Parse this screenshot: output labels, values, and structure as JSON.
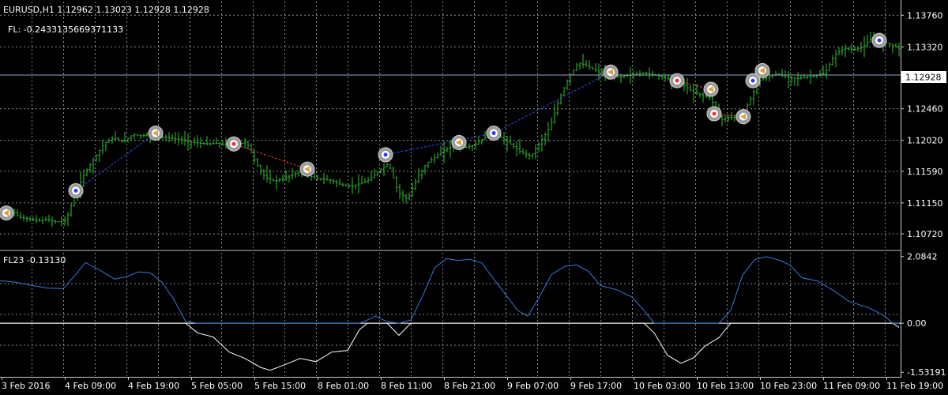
{
  "header": {
    "symbol_line": "EURUSD,H1  1.12962 1.13023 1.12928 1.12928",
    "fl_line": "FL: -0.2433135669371133"
  },
  "colors": {
    "background": "#000000",
    "grid": "#8a8a8a",
    "candle": "#2fbf2f",
    "text": "#ffffff",
    "price_line": "#8fa6c8",
    "fl_positive": "#3a78d8",
    "fl_negative": "#ffffff",
    "marker_ring": "#9a9a9a",
    "marker_buy": "#2a3cff",
    "marker_sell": "#ff2a2a",
    "marker_neutral": "#e0a040",
    "link_red": "#ff3030",
    "link_blue": "#3050ff"
  },
  "chart_data": [
    {
      "type": "line",
      "name": "price",
      "ylim": [
        1.105,
        1.1395
      ],
      "y_ticks": [
        "1.13760",
        "1.13320",
        "1.12928",
        "1.12460",
        "1.12020",
        "1.11590",
        "1.11150",
        "1.10720"
      ],
      "y_tick_values": [
        1.1376,
        1.1332,
        1.12928,
        1.1246,
        1.1202,
        1.1159,
        1.1115,
        1.1072
      ],
      "current_price": 1.12928,
      "current_price_label": "1.12928",
      "points": [
        [
          0,
          1.11
        ],
        [
          12,
          1.1108
        ],
        [
          24,
          1.1095
        ],
        [
          36,
          1.1093
        ],
        [
          48,
          1.109
        ],
        [
          60,
          1.1092
        ],
        [
          72,
          1.1088
        ],
        [
          84,
          1.1092
        ],
        [
          96,
          1.113
        ],
        [
          108,
          1.1158
        ],
        [
          120,
          1.1178
        ],
        [
          132,
          1.1198
        ],
        [
          144,
          1.1205
        ],
        [
          156,
          1.12
        ],
        [
          168,
          1.121
        ],
        [
          180,
          1.1208
        ],
        [
          192,
          1.1212
        ],
        [
          204,
          1.1207
        ],
        [
          216,
          1.1205
        ],
        [
          228,
          1.1203
        ],
        [
          240,
          1.12
        ],
        [
          252,
          1.1198
        ],
        [
          264,
          1.1197
        ],
        [
          276,
          1.1198
        ],
        [
          288,
          1.1195
        ],
        [
          300,
          1.1196
        ],
        [
          312,
          1.12
        ],
        [
          324,
          1.117
        ],
        [
          336,
          1.115
        ],
        [
          348,
          1.1145
        ],
        [
          360,
          1.115
        ],
        [
          372,
          1.1155
        ],
        [
          384,
          1.116
        ],
        [
          396,
          1.115
        ],
        [
          408,
          1.1148
        ],
        [
          420,
          1.1146
        ],
        [
          432,
          1.114
        ],
        [
          444,
          1.1138
        ],
        [
          456,
          1.1142
        ],
        [
          468,
          1.1148
        ],
        [
          480,
          1.116
        ],
        [
          492,
          1.117
        ],
        [
          504,
          1.113
        ],
        [
          516,
          1.112
        ],
        [
          528,
          1.115
        ],
        [
          540,
          1.117
        ],
        [
          552,
          1.118
        ],
        [
          564,
          1.119
        ],
        [
          576,
          1.1195
        ],
        [
          588,
          1.1192
        ],
        [
          600,
          1.1195
        ],
        [
          612,
          1.1205
        ],
        [
          624,
          1.121
        ],
        [
          636,
          1.1205
        ],
        [
          648,
          1.1195
        ],
        [
          660,
          1.1185
        ],
        [
          672,
          1.118
        ],
        [
          684,
          1.12
        ],
        [
          696,
          1.122
        ],
        [
          708,
          1.126
        ],
        [
          720,
          1.129
        ],
        [
          732,
          1.131
        ],
        [
          744,
          1.1305
        ],
        [
          756,
          1.1298
        ],
        [
          768,
          1.1293
        ],
        [
          780,
          1.129
        ],
        [
          792,
          1.1292
        ],
        [
          804,
          1.1294
        ],
        [
          816,
          1.1296
        ],
        [
          828,
          1.1293
        ],
        [
          840,
          1.129
        ],
        [
          852,
          1.1285
        ],
        [
          864,
          1.128
        ],
        [
          876,
          1.127
        ],
        [
          888,
          1.1265
        ],
        [
          900,
          1.126
        ],
        [
          912,
          1.123
        ],
        [
          924,
          1.1235
        ],
        [
          936,
          1.1232
        ],
        [
          948,
          1.1255
        ],
        [
          960,
          1.1285
        ],
        [
          972,
          1.129
        ],
        [
          984,
          1.1295
        ],
        [
          996,
          1.129
        ],
        [
          1008,
          1.1288
        ],
        [
          1020,
          1.129
        ],
        [
          1032,
          1.1292
        ],
        [
          1044,
          1.1295
        ],
        [
          1056,
          1.132
        ],
        [
          1068,
          1.133
        ],
        [
          1080,
          1.1328
        ],
        [
          1092,
          1.1332
        ],
        [
          1104,
          1.1345
        ],
        [
          1116,
          1.134
        ],
        [
          1128,
          1.1335
        ],
        [
          1138,
          1.133
        ]
      ],
      "markers": [
        {
          "x": 8,
          "y": 1.1101,
          "type": "neutral"
        },
        {
          "x": 96,
          "y": 1.1132,
          "type": "buy"
        },
        {
          "x": 197,
          "y": 1.1212,
          "type": "neutral"
        },
        {
          "x": 296,
          "y": 1.1197,
          "type": "sell"
        },
        {
          "x": 389,
          "y": 1.1162,
          "type": "neutral"
        },
        {
          "x": 488,
          "y": 1.1182,
          "type": "buy"
        },
        {
          "x": 581,
          "y": 1.1199,
          "type": "neutral"
        },
        {
          "x": 625,
          "y": 1.1212,
          "type": "buy"
        },
        {
          "x": 773,
          "y": 1.1297,
          "type": "neutral"
        },
        {
          "x": 857,
          "y": 1.1285,
          "type": "sell"
        },
        {
          "x": 900,
          "y": 1.1273,
          "type": "neutral"
        },
        {
          "x": 904,
          "y": 1.1239,
          "type": "sell"
        },
        {
          "x": 941,
          "y": 1.1235,
          "type": "neutral"
        },
        {
          "x": 953,
          "y": 1.1285,
          "type": "buy"
        },
        {
          "x": 965,
          "y": 1.1299,
          "type": "neutral"
        },
        {
          "x": 1113,
          "y": 1.1341,
          "type": "buy"
        }
      ],
      "links": [
        {
          "from": [
            96,
            1.1132
          ],
          "to": [
            197,
            1.1212
          ],
          "color": "blue"
        },
        {
          "from": [
            296,
            1.1197
          ],
          "to": [
            389,
            1.1162
          ],
          "color": "red"
        },
        {
          "from": [
            488,
            1.1182
          ],
          "to": [
            625,
            1.1212
          ],
          "color": "blue"
        },
        {
          "from": [
            625,
            1.1212
          ],
          "to": [
            773,
            1.1297
          ],
          "color": "blue"
        },
        {
          "from": [
            857,
            1.1285
          ],
          "to": [
            900,
            1.1273
          ],
          "color": "red"
        },
        {
          "from": [
            904,
            1.1239
          ],
          "to": [
            941,
            1.1235
          ],
          "color": "red"
        }
      ]
    },
    {
      "type": "line",
      "name": "FL23",
      "label": "FL23 -0.13130",
      "ylim": [
        -1.65,
        2.2
      ],
      "y_ticks": [
        "2.0842",
        "0.00",
        "-1.53191"
      ],
      "y_tick_values": [
        2.0842,
        0.0,
        -1.53191
      ],
      "points": [
        [
          0,
          1.33
        ],
        [
          20,
          1.28
        ],
        [
          40,
          1.18
        ],
        [
          60,
          1.1
        ],
        [
          80,
          1.08
        ],
        [
          95,
          1.5
        ],
        [
          108,
          1.9
        ],
        [
          125,
          1.68
        ],
        [
          145,
          1.38
        ],
        [
          160,
          1.45
        ],
        [
          175,
          1.6
        ],
        [
          190,
          1.58
        ],
        [
          205,
          1.28
        ],
        [
          220,
          0.75
        ],
        [
          235,
          0.05
        ],
        [
          250,
          -0.3
        ],
        [
          270,
          -0.43
        ],
        [
          290,
          -0.9
        ],
        [
          310,
          -1.1
        ],
        [
          330,
          -1.38
        ],
        [
          342,
          -1.47
        ],
        [
          360,
          -1.3
        ],
        [
          380,
          -1.1
        ],
        [
          400,
          -1.2
        ],
        [
          420,
          -0.9
        ],
        [
          440,
          -0.85
        ],
        [
          455,
          -0.2
        ],
        [
          465,
          0.1
        ],
        [
          475,
          0.22
        ],
        [
          490,
          0.05
        ],
        [
          505,
          -0.38
        ],
        [
          520,
          0.1
        ],
        [
          535,
          0.85
        ],
        [
          550,
          1.72
        ],
        [
          565,
          2.02
        ],
        [
          580,
          1.96
        ],
        [
          595,
          2.0
        ],
        [
          610,
          1.88
        ],
        [
          625,
          1.38
        ],
        [
          640,
          0.9
        ],
        [
          655,
          0.4
        ],
        [
          668,
          0.22
        ],
        [
          682,
          0.78
        ],
        [
          698,
          1.52
        ],
        [
          715,
          1.78
        ],
        [
          730,
          1.82
        ],
        [
          745,
          1.62
        ],
        [
          760,
          1.18
        ],
        [
          780,
          1.05
        ],
        [
          800,
          0.82
        ],
        [
          815,
          0.4
        ],
        [
          828,
          -0.3
        ],
        [
          845,
          -1.0
        ],
        [
          862,
          -1.25
        ],
        [
          878,
          -1.08
        ],
        [
          892,
          -0.72
        ],
        [
          910,
          -0.45
        ],
        [
          925,
          0.4
        ],
        [
          940,
          1.5
        ],
        [
          955,
          1.98
        ],
        [
          970,
          2.08
        ],
        [
          985,
          1.98
        ],
        [
          1000,
          1.82
        ],
        [
          1015,
          1.42
        ],
        [
          1035,
          1.32
        ],
        [
          1055,
          1.02
        ],
        [
          1075,
          0.68
        ],
        [
          1100,
          0.48
        ],
        [
          1120,
          0.22
        ],
        [
          1130,
          0.0
        ],
        [
          1138,
          -0.13
        ]
      ]
    }
  ],
  "x_axis": {
    "labels": [
      "3 Feb 2016",
      "4 Feb 09:00",
      "4 Feb 19:00",
      "5 Feb 05:00",
      "5 Feb 15:00",
      "8 Feb 01:00",
      "8 Feb 11:00",
      "8 Feb 21:00",
      "9 Feb 07:00",
      "9 Feb 17:00",
      "10 Feb 03:00",
      "10 Feb 13:00",
      "10 Feb 23:00",
      "11 Feb 09:00",
      "11 Feb 19:00"
    ]
  }
}
